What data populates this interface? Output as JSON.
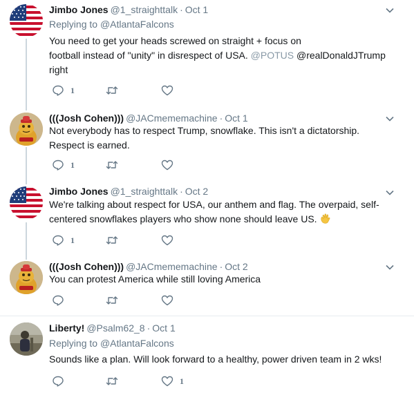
{
  "tweets": [
    {
      "name": "Jimbo Jones",
      "handle": "@1_straighttalk",
      "separator": "·",
      "date": "Oct 1",
      "replying_prefix": "Replying to",
      "replying_to": "@AtlantaFalcons",
      "text_line1": "You need to get your heads screwed on straight +  focus on",
      "text_line2_a": "football instead of \"unity\" in disrespect of USA.",
      "text_line2_mention1": "@POTUS",
      "text_line2_mention2": "@realDonaldJTrump",
      "text_line3": "right",
      "reply_count": "1",
      "like_count": ""
    },
    {
      "name": "(((Josh Cohen)))",
      "handle": "@JACmememachine",
      "separator": "·",
      "date": "Oct 1",
      "text_line1": "Not everybody has to respect Trump, snowflake. This isn't a dictatorship.",
      "text_line2": "Respect is earned.",
      "reply_count": "1"
    },
    {
      "name": "Jimbo Jones",
      "handle": "@1_straighttalk",
      "separator": "·",
      "date": "Oct 2",
      "text_line1": "We're talking about respect for USA, our anthem and flag. The overpaid, self-",
      "text_line2": "centered snowflakes players who show none should leave US.",
      "reply_count": "1"
    },
    {
      "name": "(((Josh Cohen)))",
      "handle": "@JACmememachine",
      "separator": "·",
      "date": "Oct 2",
      "text_line1": "You can protest America while still loving America"
    },
    {
      "name": "Liberty!",
      "handle": "@Psalm62_8",
      "separator": "·",
      "date": "Oct 1",
      "replying_prefix": "Replying to",
      "replying_to": "@AtlantaFalcons",
      "text_line1": "Sounds like a plan.  Will look forward to a healthy, power driven team in 2 wks!",
      "like_count": "1"
    }
  ],
  "colors": {
    "text": "#14171a",
    "muted": "#657786",
    "thread_line": "#ccd6dd",
    "divider": "#e6ecf0"
  },
  "icons": [
    "reply-icon",
    "retweet-icon",
    "like-icon",
    "chevron-down-icon",
    "waving-hand-emoji"
  ]
}
